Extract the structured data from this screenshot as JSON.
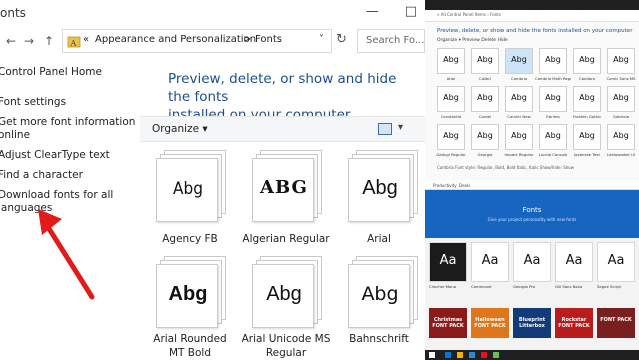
{
  "window": {
    "title_fragment": "onts",
    "min_icon": "minimize-icon",
    "max_icon": "maximize-icon"
  },
  "address_bar": {
    "back_glyph": "←",
    "forward_glyph": "→",
    "up_glyph": "↑",
    "separator": "«",
    "crumbs": [
      "Appearance and Personalization",
      "Fonts"
    ],
    "chevron": ">",
    "dropdown": "˅",
    "refresh": "↻",
    "search_placeholder": "Search Fo..."
  },
  "sidebar": {
    "items": [
      "Control Panel Home",
      "Font settings",
      "Get more font information",
      "online",
      "Adjust ClearType text",
      "Find a character",
      "Download fonts for all",
      "languages"
    ]
  },
  "main": {
    "heading_line1": "Preview, delete, or show and hide the fonts",
    "heading_line2": "installed on your computer",
    "organize": "Organize ▾",
    "view_dropdown": "▾"
  },
  "fonts": [
    {
      "sample": "Abg",
      "name_line1": "Agency FB",
      "name_line2": ""
    },
    {
      "sample": "ABG",
      "name_line1": "Algerian Regular",
      "name_line2": ""
    },
    {
      "sample": "Abg",
      "name_line1": "Arial",
      "name_line2": ""
    },
    {
      "sample": "Abg",
      "name_line1": "Arial Rounded",
      "name_line2": "MT Bold"
    },
    {
      "sample": "Abg",
      "name_line1": "Arial Unicode MS",
      "name_line2": "Regular"
    },
    {
      "sample": "Abg",
      "name_line1": "Bahnschrift",
      "name_line2": ""
    }
  ],
  "right_top": {
    "address": "«  All Control Panel Items  ›  Fonts",
    "heading": "Preview, delete, or show and hide the fonts installed on your computer",
    "commands": "Organize ▾    Preview    Delete    Hide",
    "fonts": [
      {
        "s": "Abg",
        "n": "Arial"
      },
      {
        "s": "Abg",
        "n": "Calibri"
      },
      {
        "s": "Abg",
        "n": "Cambria"
      },
      {
        "s": "Abg",
        "n": "Cambria Math Regular"
      },
      {
        "s": "Abg",
        "n": "Candara"
      },
      {
        "s": "Abg",
        "n": "Comic Sans MS"
      },
      {
        "s": "Abg",
        "n": "Constantia"
      },
      {
        "s": "Abg",
        "n": "Corbel"
      },
      {
        "s": "Abg",
        "n": "Courier New"
      },
      {
        "s": "Abg",
        "n": "Ebrima"
      },
      {
        "s": "Abg",
        "n": "Franklin Gothic"
      },
      {
        "s": "Abg",
        "n": "Gabriola"
      },
      {
        "s": "Abg",
        "n": "Gadugi Regular"
      },
      {
        "s": "Abg",
        "n": "Georgia"
      },
      {
        "s": "Abg",
        "n": "Impact Regular"
      },
      {
        "s": "Abg",
        "n": "Lucida Console"
      },
      {
        "s": "Abg",
        "n": "Javanese Text"
      },
      {
        "s": "Abg",
        "n": "Leelawadee UI"
      }
    ],
    "status": "Cambria   Font style: Regular, Bold, Bold Italic, Italic    Show/hide: Show"
  },
  "right_bottom": {
    "tabs": [
      "Productivity",
      "Deals"
    ],
    "banner_title": "Fonts",
    "banner_subtitle": "Give your project personality with new fonts",
    "cards": [
      {
        "s": "Aa",
        "n": "Clincher Mono",
        "dark": true
      },
      {
        "s": "Aa",
        "n": "Commoner",
        "dark": false
      },
      {
        "s": "Aa",
        "n": "Georgia Pro",
        "dark": false
      },
      {
        "s": "Aa",
        "n": "Gill Sans Nova",
        "dark": false
      },
      {
        "s": "Aa",
        "n": "Segoe Script",
        "dark": false
      }
    ],
    "packs": [
      {
        "s": "Christmas FONT PACK",
        "color": "#8b1a1a"
      },
      {
        "s": "Halloween FONT PACK",
        "color": "#e0761b"
      },
      {
        "s": "Blueprint Litterbox",
        "color": "#123b77"
      },
      {
        "s": "Rockstar FONT PACK",
        "color": "#b91c1c"
      },
      {
        "s": "FONT PACK",
        "color": "#7a1f1f"
      }
    ]
  },
  "colors": {
    "heading_blue": "#1e4e8c",
    "arrow_red": "#e31a1a",
    "banner_blue": "#1666c1"
  }
}
